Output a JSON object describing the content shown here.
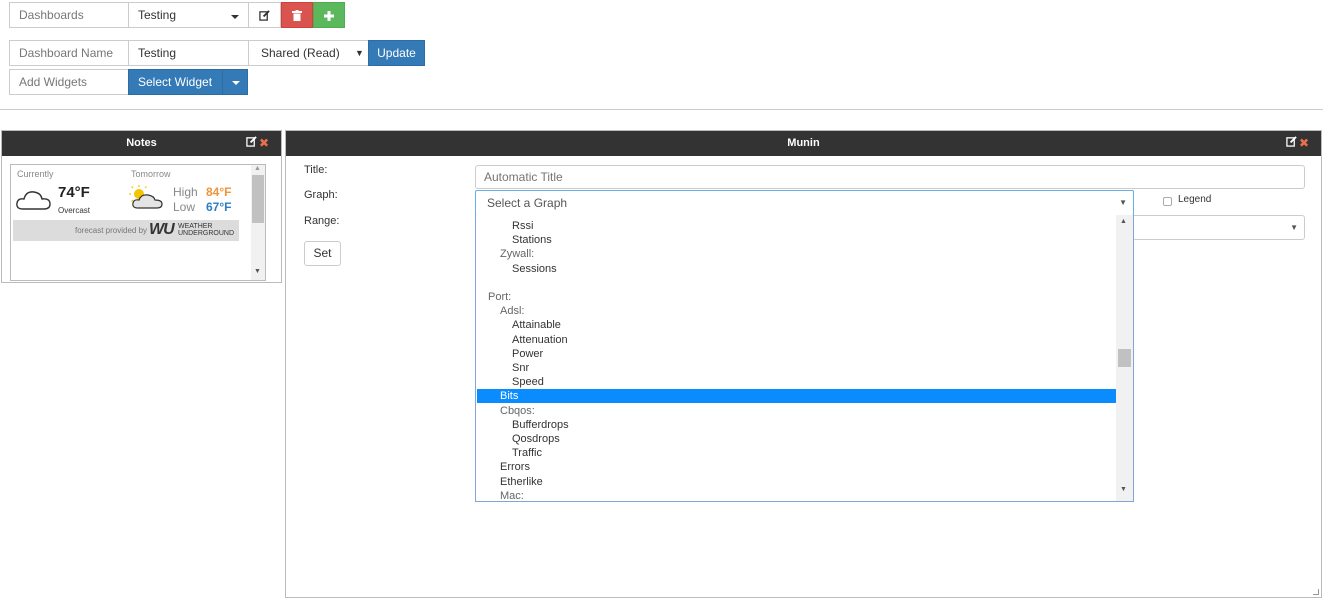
{
  "toolbar": {
    "dashboards_label": "Dashboards",
    "dashboard_selected": "Testing",
    "dashboard_name_label": "Dashboard Name",
    "dashboard_name_value": "Testing",
    "access_selected": "Shared (Read)",
    "update_label": "Update",
    "add_widgets_label": "Add Widgets",
    "select_widget_label": "Select Widget",
    "colors": {
      "primary": "#337ab7",
      "danger": "#d9534f",
      "success": "#5cb85c"
    }
  },
  "notes_widget": {
    "title": "Notes",
    "weather": {
      "currently_label": "Currently",
      "current_temp": "74°F",
      "current_condition": "Overcast",
      "tomorrow_label": "Tomorrow",
      "high_label": "High",
      "high_temp": "84°F",
      "low_label": "Low",
      "low_temp": "67°F",
      "footer_text": "forecast provided by",
      "brand_line1": "WEATHER",
      "brand_line2": "UNDERGROUND",
      "high_color": "#f0943a",
      "low_color": "#2a7fc1"
    }
  },
  "munin_widget": {
    "title": "Munin",
    "title_label": "Title:",
    "title_placeholder": "Automatic Title",
    "graph_label": "Graph:",
    "graph_placeholder": "Select a Graph",
    "legend_label": "Legend",
    "range_label": "Range:",
    "set_label": "Set",
    "dropdown_items": [
      {
        "text": "Rssi",
        "level": 2,
        "kind": "option"
      },
      {
        "text": "Stations",
        "level": 2,
        "kind": "option"
      },
      {
        "text": "Zywall:",
        "level": 1,
        "kind": "group"
      },
      {
        "text": "Sessions",
        "level": 2,
        "kind": "option"
      },
      {
        "text": "",
        "level": 0,
        "kind": "blank"
      },
      {
        "text": "Port:",
        "level": 0,
        "kind": "group"
      },
      {
        "text": "Adsl:",
        "level": 1,
        "kind": "group"
      },
      {
        "text": "Attainable",
        "level": 2,
        "kind": "option"
      },
      {
        "text": "Attenuation",
        "level": 2,
        "kind": "option"
      },
      {
        "text": "Power",
        "level": 2,
        "kind": "option"
      },
      {
        "text": "Snr",
        "level": 2,
        "kind": "option"
      },
      {
        "text": "Speed",
        "level": 2,
        "kind": "option"
      },
      {
        "text": "Bits",
        "level": 1,
        "kind": "selected"
      },
      {
        "text": "Cbqos:",
        "level": 1,
        "kind": "group"
      },
      {
        "text": "Bufferdrops",
        "level": 2,
        "kind": "option"
      },
      {
        "text": "Qosdrops",
        "level": 2,
        "kind": "option"
      },
      {
        "text": "Traffic",
        "level": 2,
        "kind": "option"
      },
      {
        "text": "Errors",
        "level": 1,
        "kind": "option"
      },
      {
        "text": "Etherlike",
        "level": 1,
        "kind": "option"
      },
      {
        "text": "Mac:",
        "level": 1,
        "kind": "group"
      }
    ],
    "highlight_color": "#0a8cff"
  }
}
